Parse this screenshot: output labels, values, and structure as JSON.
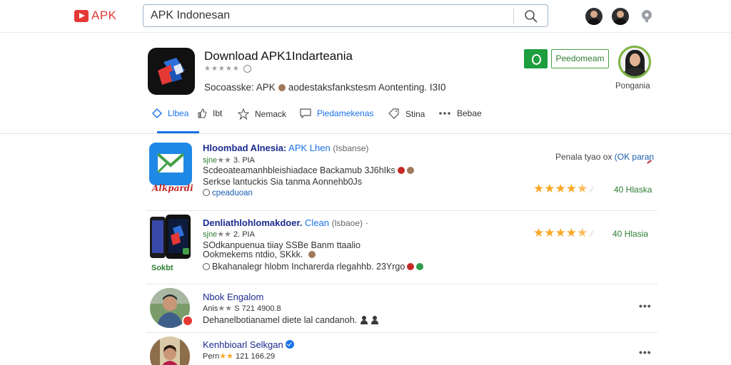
{
  "topbar": {
    "logo_text": "APK",
    "search_value": "APK Indonesan",
    "search_placeholder": "APK Indonesan"
  },
  "app": {
    "title": "Download APK1Indarteania",
    "rating_stars": "★★★★★",
    "description": "Socoasske: APK",
    "description_tail": "aodestaksfankstesm Aontenting. I3I0",
    "primary_button_label": "Peedomeam",
    "profile_name": "Pongania"
  },
  "tabs": [
    {
      "label": "Llbea",
      "icon": "diamond-icon",
      "active": true
    },
    {
      "label": "Ibt",
      "icon": "thumb-up-icon",
      "active": false
    },
    {
      "label": "Nemack",
      "icon": "star-outline-icon",
      "active": false
    },
    {
      "label": "Piedamekenas",
      "icon": "chat-bubble-icon",
      "active": false
    },
    {
      "label": "Stina",
      "icon": "tag-icon",
      "active": false
    },
    {
      "label": "Bebae",
      "icon": "more-icon",
      "active": false
    }
  ],
  "results": [
    {
      "title": "Hloombad Alnesia:",
      "title_accent": "APK Lhen",
      "title_paren": "(Isbanse)",
      "meta_label": "sjne",
      "meta_rest": "3. PIA",
      "line1": "Scdeoateamanhbleishiadace Backamub 3J6hIks",
      "line2": "Serkse lantuckis Sia tanma Aonnehb0Js",
      "link": "cpeaduoan",
      "right_note": "Penala tyao ox",
      "right_note_accent": "(OK paran",
      "rating": 4.5,
      "score": "40 Hlaska",
      "thumb_caption": "Alkpardip"
    },
    {
      "title": "Denliathlohlomakdoer.",
      "title_accent": "Clean",
      "title_paren": "(lsbaoe)",
      "meta_label": "sjne",
      "meta_rest": "2. PIA",
      "line1": "SOdkanpuenua tiiay SSBe Banm ttaalio",
      "line2": "Ookmekems ntdio, SKkk.",
      "line3": "Bkahanalegr hlobm Incharerda rlegahhb. 23Yrgo",
      "thumb_caption": "Sokbt",
      "rating": 4.5,
      "score": "40 Hlasia"
    },
    {
      "title": "Nbok Engalom",
      "meta_label": "Anis",
      "meta_rest": "S 721 4900.8",
      "line1": "Dehanelbotianamel diete lal candanoh.",
      "more": "•••"
    },
    {
      "title": "Kenhbioarl Selkgan",
      "meta_label": "Pern",
      "meta_rest": "121 166.29",
      "more": "•••"
    }
  ],
  "colors": {
    "accent_blue": "#1a73e8",
    "brand_red": "#e53935",
    "green": "#2e7d32",
    "star": "#f9a825",
    "title_navy": "#1c2b8f"
  }
}
